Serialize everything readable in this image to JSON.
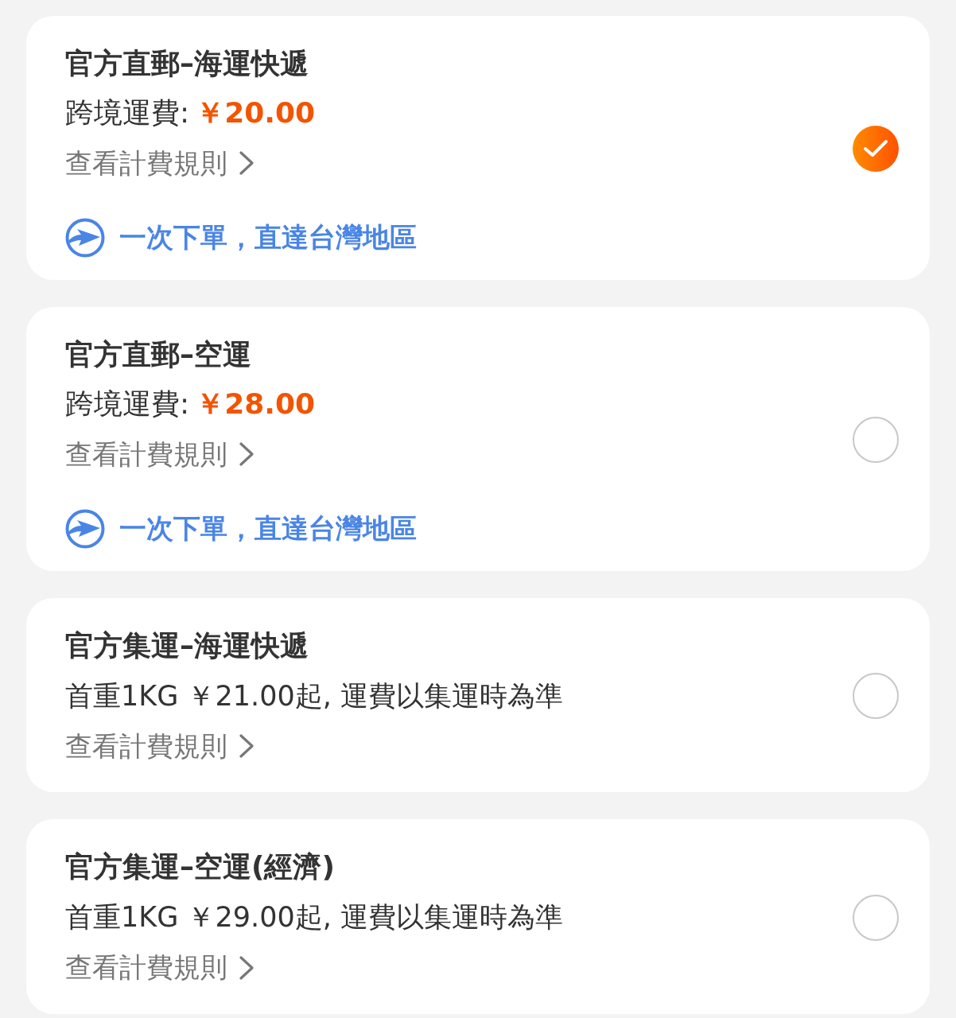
{
  "options": [
    {
      "kind": "fixed_price",
      "title": "官方直郵–海運快遞",
      "price_label": "跨境運費:",
      "price": "￥20.00",
      "rules_link": "查看計費規則",
      "note": "一次下單，直達台灣地區",
      "selected": true
    },
    {
      "kind": "fixed_price",
      "title": "官方直郵–空運",
      "price_label": "跨境運費:",
      "price": "￥28.00",
      "rules_link": "查看計費規則",
      "note": "一次下單，直達台灣地區",
      "selected": false
    },
    {
      "kind": "starting_price",
      "title": "官方集運–海運快遞",
      "description": "首重1KG ￥21.00起, 運費以集運時為準",
      "rules_link": "查看計費規則",
      "selected": false
    },
    {
      "kind": "starting_price",
      "title": "官方集運–空運(經濟)",
      "description": "首重1KG ￥29.00起, 運費以集運時為準",
      "rules_link": "查看計費規則",
      "selected": false
    }
  ]
}
